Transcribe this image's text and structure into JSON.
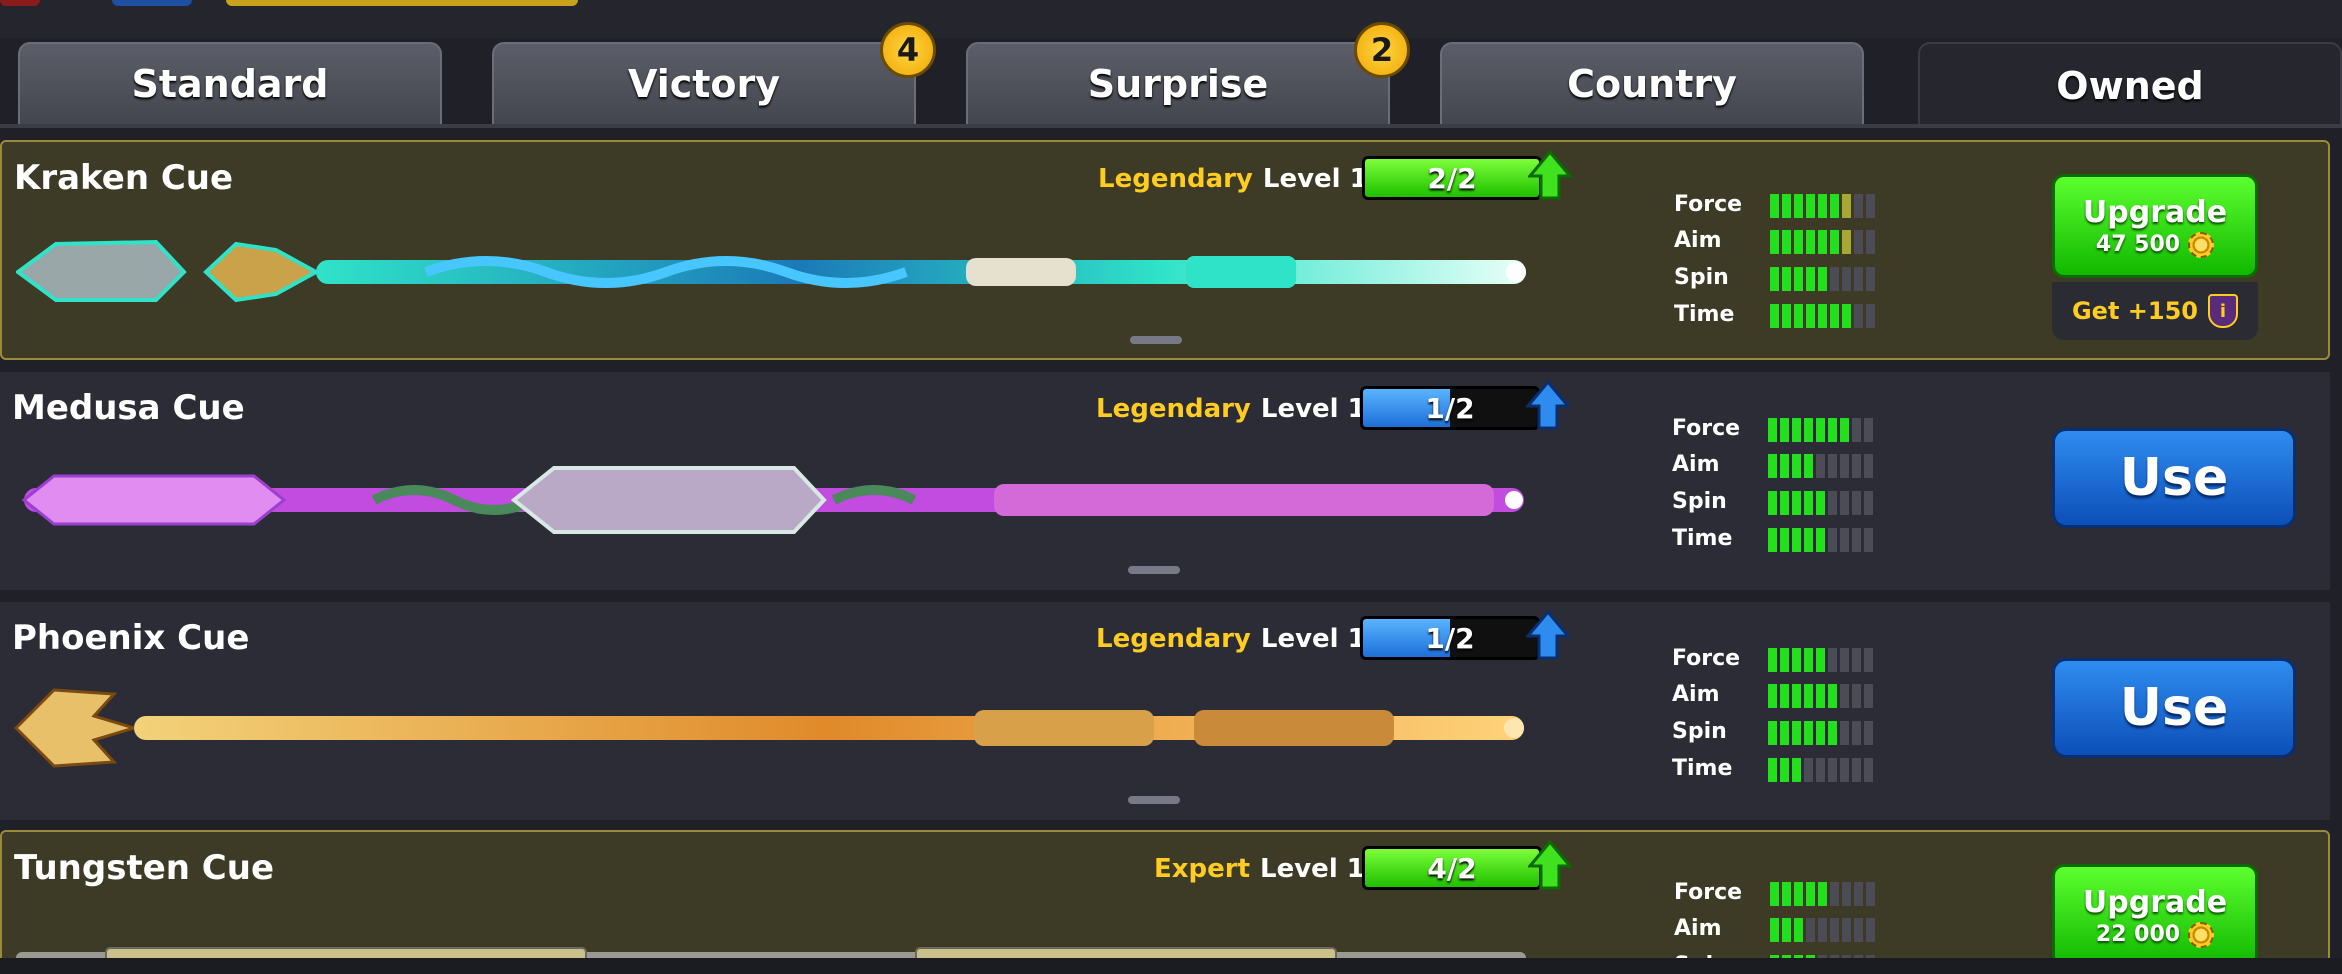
{
  "tabs": [
    {
      "label": "Standard",
      "badge": null
    },
    {
      "label": "Victory",
      "badge": "4"
    },
    {
      "label": "Surprise",
      "badge": "2"
    },
    {
      "label": "Country",
      "badge": null
    },
    {
      "label": "Owned",
      "badge": null
    }
  ],
  "active_tab": "Owned",
  "colors": {
    "rarity_text": "#ffcc22",
    "stat_on": "#22e01c",
    "stat_upgrade": "#a6a832",
    "upgrade_button": "#22d20c",
    "use_button": "#1e6fd8"
  },
  "cues": [
    {
      "name": "Kraken Cue",
      "rarity": "Legendary",
      "level": "Level 1",
      "progress": "2/2",
      "progress_fraction": 1.0,
      "progress_color": "green",
      "stats": [
        {
          "label": "Force",
          "value": 6,
          "upgrade": 1,
          "max": 9
        },
        {
          "label": "Aim",
          "value": 6,
          "upgrade": 1,
          "max": 9
        },
        {
          "label": "Spin",
          "value": 5,
          "upgrade": 0,
          "max": 9
        },
        {
          "label": "Time",
          "value": 7,
          "upgrade": 0,
          "max": 9
        }
      ],
      "action": "upgrade",
      "action_label": "Upgrade",
      "price": "47 500",
      "bonus": "Get +150",
      "cue_art": "kraken-cue-image"
    },
    {
      "name": "Medusa Cue",
      "rarity": "Legendary",
      "level": "Level 1",
      "progress": "1/2",
      "progress_fraction": 0.5,
      "progress_color": "blue",
      "stats": [
        {
          "label": "Force",
          "value": 7,
          "upgrade": 0,
          "max": 9
        },
        {
          "label": "Aim",
          "value": 4,
          "upgrade": 0,
          "max": 9
        },
        {
          "label": "Spin",
          "value": 5,
          "upgrade": 0,
          "max": 9
        },
        {
          "label": "Time",
          "value": 5,
          "upgrade": 0,
          "max": 9
        }
      ],
      "action": "use",
      "action_label": "Use",
      "cue_art": "medusa-cue-image"
    },
    {
      "name": "Phoenix Cue",
      "rarity": "Legendary",
      "level": "Level 1",
      "progress": "1/2",
      "progress_fraction": 0.5,
      "progress_color": "blue",
      "stats": [
        {
          "label": "Force",
          "value": 5,
          "upgrade": 0,
          "max": 9
        },
        {
          "label": "Aim",
          "value": 6,
          "upgrade": 0,
          "max": 9
        },
        {
          "label": "Spin",
          "value": 6,
          "upgrade": 0,
          "max": 9
        },
        {
          "label": "Time",
          "value": 3,
          "upgrade": 0,
          "max": 9
        }
      ],
      "action": "use",
      "action_label": "Use",
      "cue_art": "phoenix-cue-image"
    },
    {
      "name": "Tungsten Cue",
      "rarity": "Expert",
      "level": "Level 1",
      "progress": "4/2",
      "progress_fraction": 1.0,
      "progress_color": "green",
      "stats": [
        {
          "label": "Force",
          "value": 5,
          "upgrade": 0,
          "max": 9
        },
        {
          "label": "Aim",
          "value": 3,
          "upgrade": 0,
          "max": 9
        },
        {
          "label": "Spin",
          "value": 4,
          "upgrade": 0,
          "max": 9
        }
      ],
      "action": "upgrade",
      "action_label": "Upgrade",
      "price": "22 000",
      "cue_art": "tungsten-cue-image"
    }
  ]
}
